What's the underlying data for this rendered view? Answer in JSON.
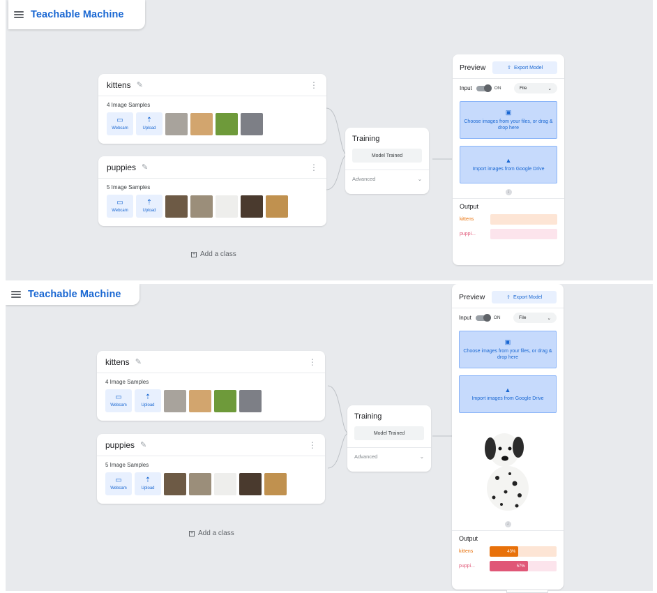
{
  "app": {
    "title": "Teachable Machine"
  },
  "classes": [
    {
      "name": "kittens",
      "samples_label": "4 Image Samples",
      "thumbs": [
        "#a8a39c",
        "#d2a56e",
        "#6e9a3a",
        "#7d7f86"
      ]
    },
    {
      "name": "puppies",
      "samples_label": "5 Image Samples",
      "thumbs": [
        "#6d5a45",
        "#9b8e7a",
        "#eeeeec",
        "#4a3a2e",
        "#c0914f"
      ]
    }
  ],
  "sample_sources": {
    "webcam": "Webcam",
    "upload": "Upload"
  },
  "add_class": "Add a class",
  "training": {
    "title": "Training",
    "button": "Model Trained",
    "advanced": "Advanced"
  },
  "preview": {
    "title": "Preview",
    "export": "Export Model",
    "input_label": "Input",
    "toggle_state": "ON",
    "source_select": "File",
    "drop_files": "Choose images from your files, or drag & drop here",
    "drive": "Import images from Google Drive",
    "output_title": "Output",
    "outputs_empty": [
      {
        "label": "kittens",
        "color": "#e8710a",
        "track": "#fde5d5"
      },
      {
        "label": "puppi...",
        "color": "#e05777",
        "track": "#fce4ec"
      }
    ],
    "outputs_result": [
      {
        "label": "kittens",
        "color": "#e8710a",
        "track": "#fde5d5",
        "value": 0.43,
        "value_label": "43%"
      },
      {
        "label": "puppi...",
        "color": "#e05777",
        "track": "#fce4ec",
        "value": 0.57,
        "value_label": "57%"
      }
    ]
  }
}
